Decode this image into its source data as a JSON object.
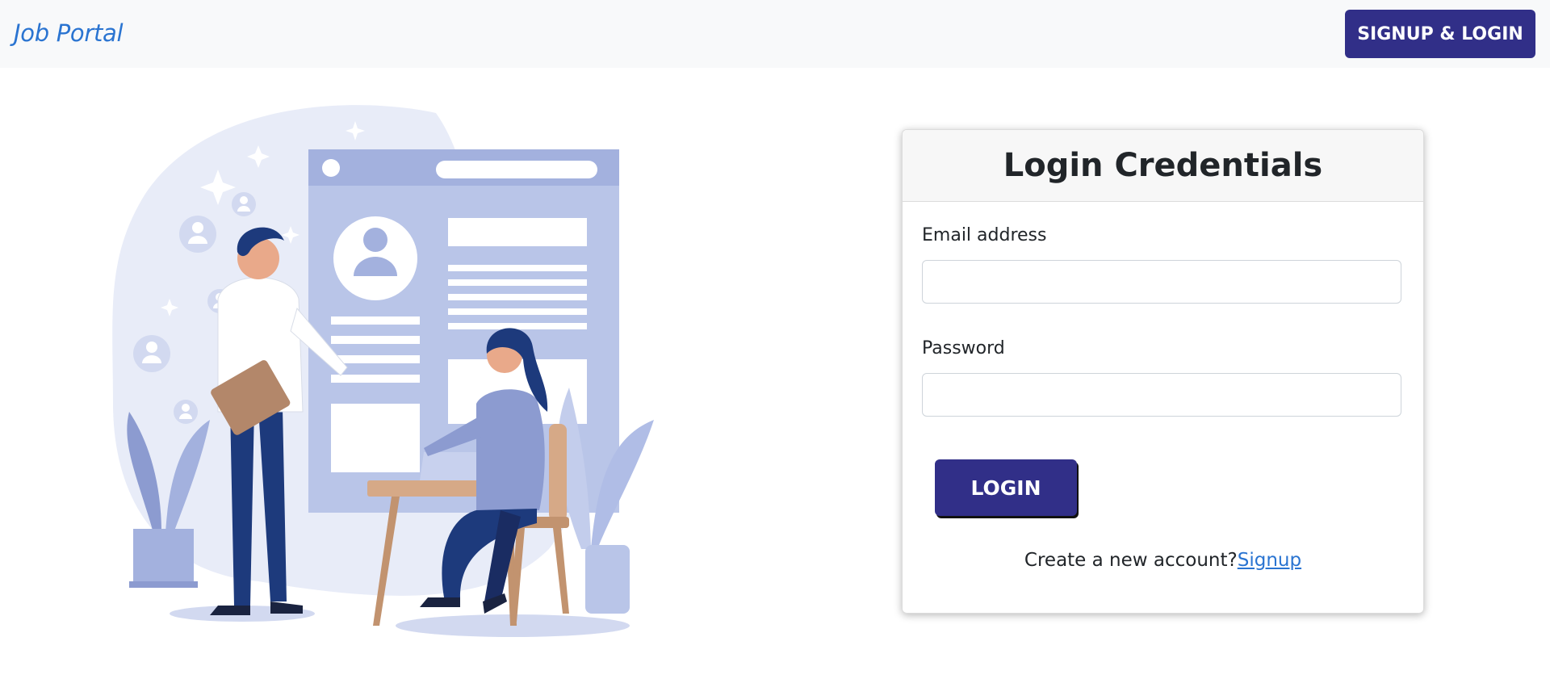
{
  "navbar": {
    "brand": "Job Portal",
    "signup_login_label": "SIGNUP & LOGIN"
  },
  "login_card": {
    "title": "Login Credentials",
    "email_label": "Email address",
    "email_value": "",
    "password_label": "Password",
    "password_value": "",
    "login_button_label": "LOGIN",
    "signup_prompt": "Create a new account?",
    "signup_link": "Signup"
  },
  "colors": {
    "brand": "#2a74d1",
    "primary_button": "#312f88",
    "navbar_bg": "#f8f9fa",
    "illustration_main": "#a9b7e2",
    "illustration_dark": "#1d3a7c"
  }
}
